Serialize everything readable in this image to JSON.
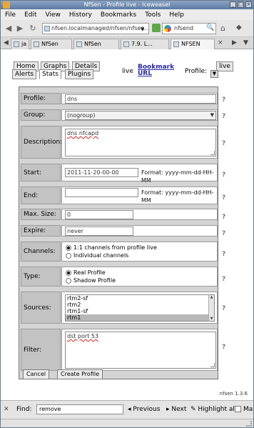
{
  "window": {
    "title": "NfSen - Profile live - Iceweasel"
  },
  "menu": [
    "File",
    "Edit",
    "View",
    "History",
    "Bookmarks",
    "Tools",
    "Help"
  ],
  "nav": {
    "url": "nfsen.localmanaged/nfsen/nfsen...",
    "search": "nfsend"
  },
  "tabs": [
    {
      "label": "ja"
    },
    {
      "label": "NfSen"
    },
    {
      "label": "NfSen"
    },
    {
      "label": "7.9. L..."
    },
    {
      "label": "NFSEN"
    }
  ],
  "nfsen": {
    "tabs_top": [
      "Home",
      "Graphs",
      "Details"
    ],
    "tabs_bottom": [
      "Alerts",
      "Stats",
      "Plugins"
    ],
    "live_label": "live",
    "bookmark_label": "Bookmark",
    "url_label": "URL",
    "profile_label": "Profile:",
    "profile_value": "live"
  },
  "form": {
    "profile": {
      "label": "Profile:",
      "value": "dns"
    },
    "group": {
      "label": "Group:",
      "value": "(nogroup)"
    },
    "description": {
      "label": "Description:",
      "value": "dns nfcapd"
    },
    "start": {
      "label": "Start:",
      "value": "2011-11-20-00-00",
      "format": "Format: yyyy-mm-dd-HH-MM"
    },
    "end": {
      "label": "End:",
      "value": "",
      "format": "Format: yyyy-mm-dd-HH-MM"
    },
    "max_size": {
      "label": "Max. Size:",
      "value": "0"
    },
    "expire": {
      "label": "Expire:",
      "value": "never"
    },
    "channels": {
      "label": "Channels:",
      "options": [
        "1:1 channels from profile live",
        "Individual channels"
      ],
      "selected": 0
    },
    "type": {
      "label": "Type:",
      "options": [
        "Real Profile",
        "Shadow Profile"
      ],
      "selected": 0
    },
    "sources": {
      "label": "Sources:",
      "items": [
        "rtm2-sf",
        "rtm2",
        "rtm1-sf",
        "rtm1"
      ],
      "selected": 3
    },
    "filter": {
      "label": "Filter:",
      "value": "dst port 53"
    },
    "buttons": {
      "cancel": "Cancel",
      "create": "Create Profile"
    },
    "filter_info": "nfsen 1.3.6"
  },
  "findbar": {
    "label": "Find:",
    "value": "remove",
    "previous": "Previous",
    "next": "Next",
    "highlight": "Highlight all",
    "match_case": "Ma"
  }
}
